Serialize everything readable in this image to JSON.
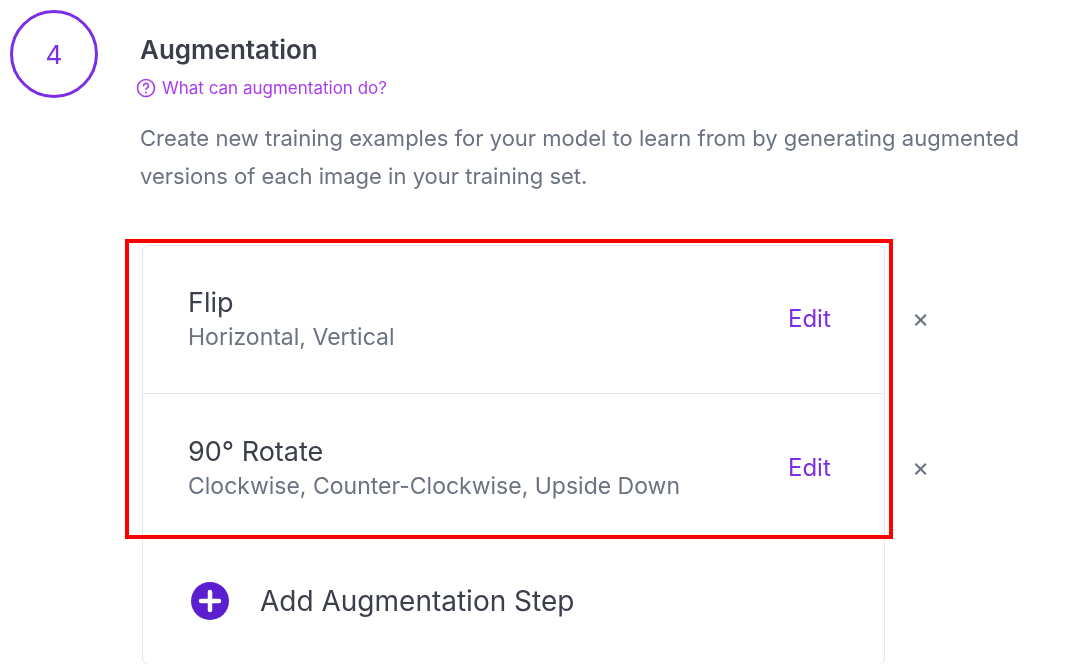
{
  "step": {
    "number": "4",
    "title": "Augmentation"
  },
  "help_link": "What can augmentation do?",
  "description": "Create new training examples for your model to learn from by generating augmented versions of each image in your training set.",
  "augmentations": [
    {
      "name": "Flip",
      "options": "Horizontal, Vertical",
      "action": "Edit",
      "remove": "×"
    },
    {
      "name": "90° Rotate",
      "options": "Clockwise, Counter-Clockwise, Upside Down",
      "action": "Edit",
      "remove": "×"
    }
  ],
  "add_button": "Add Augmentation Step"
}
